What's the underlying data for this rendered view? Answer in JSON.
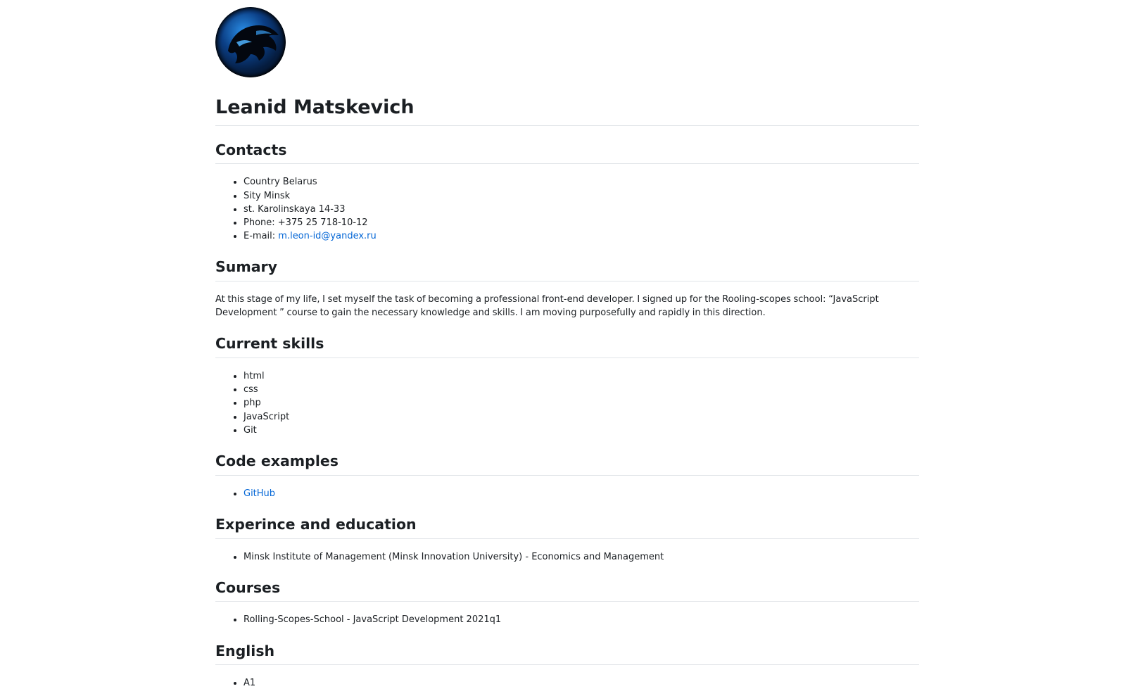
{
  "profile": {
    "name": "Leanid Matskevich"
  },
  "contacts": {
    "heading": "Contacts",
    "country": "Country Belarus",
    "city": "Sity Minsk",
    "street": "st. Karolinskaya 14-33",
    "phone": "Phone: +375 25 718-10-12",
    "email_label": "E-mail: ",
    "email_link": "m.leon-id@yandex.ru"
  },
  "summary": {
    "heading": "Sumary",
    "text": "At this stage of my life, I set myself the task of becoming a professional front-end developer. I signed up for the Rooling-scopes school: “JavaScript Development ” course to gain the necessary knowledge and skills. I am moving purposefully and rapidly in this direction."
  },
  "skills": {
    "heading": "Current skills",
    "items": [
      "html",
      "css",
      "php",
      "JavaScript",
      "Git"
    ]
  },
  "code": {
    "heading": "Code examples",
    "link": "GitHub"
  },
  "experience": {
    "heading": "Experince and education",
    "items": [
      "Minsk Institute of Management (Minsk Innovation University) - Economics and Management"
    ]
  },
  "courses": {
    "heading": "Courses",
    "items": [
      "Rolling-Scopes-School - JavaScript Development 2021q1"
    ]
  },
  "english": {
    "heading": "English",
    "items": [
      "A1"
    ]
  },
  "colors": {
    "link": "#0366d6",
    "divider": "#e1e4e8",
    "text": "#1b1f23"
  }
}
